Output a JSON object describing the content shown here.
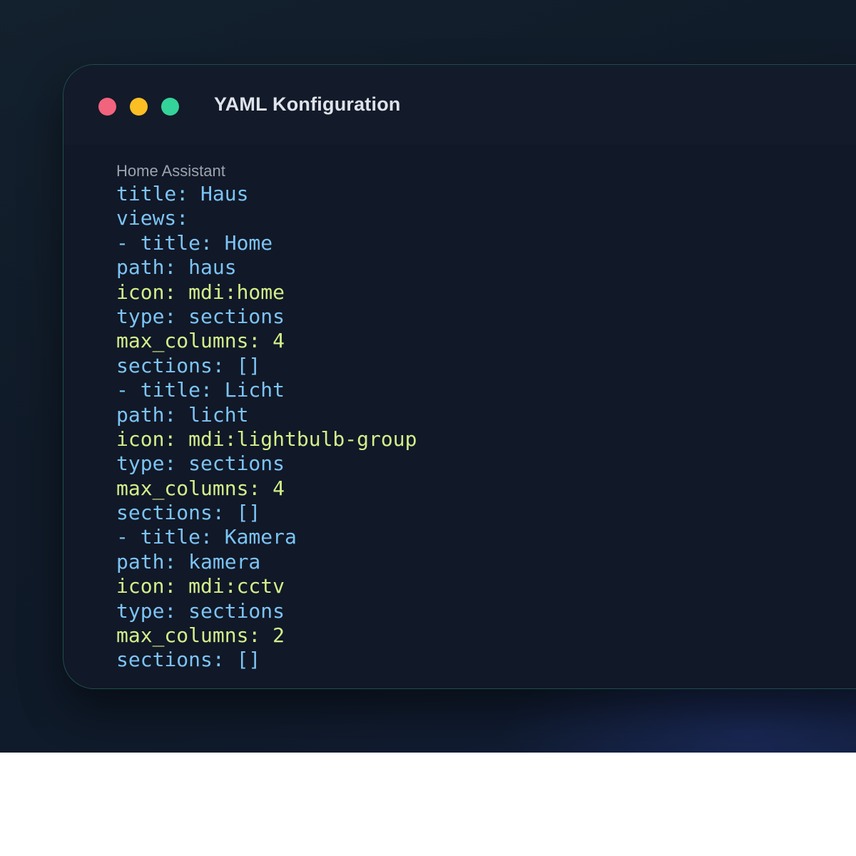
{
  "window": {
    "title": "YAML Konfiguration",
    "controls": {
      "close_color": "#f2637e",
      "minimize_color": "#fbbf24",
      "maximize_color": "#34d399"
    }
  },
  "editor": {
    "caption": "Home Assistant",
    "colors": {
      "key_blue": "#7cc4f5",
      "value_green": "#d4ee8b"
    },
    "lines": [
      {
        "text": "title: Haus",
        "color": "blue"
      },
      {
        "text": "views:",
        "color": "blue"
      },
      {
        "text": "- title: Home",
        "color": "blue"
      },
      {
        "text": "path: haus",
        "color": "blue"
      },
      {
        "text": "icon: mdi:home",
        "color": "green"
      },
      {
        "text": "type: sections",
        "color": "blue"
      },
      {
        "text": "max_columns: 4",
        "color": "green"
      },
      {
        "text": "sections: []",
        "color": "blue"
      },
      {
        "text": "- title: Licht",
        "color": "blue"
      },
      {
        "text": "path: licht",
        "color": "blue"
      },
      {
        "text": "icon: mdi:lightbulb-group",
        "color": "green"
      },
      {
        "text": "type: sections",
        "color": "blue"
      },
      {
        "text": "max_columns: 4",
        "color": "green"
      },
      {
        "text": "sections: []",
        "color": "blue"
      },
      {
        "text": "- title: Kamera",
        "color": "blue"
      },
      {
        "text": "path: kamera",
        "color": "blue"
      },
      {
        "text": "icon: mdi:cctv",
        "color": "green"
      },
      {
        "text": "type: sections",
        "color": "blue"
      },
      {
        "text": "max_columns: 2",
        "color": "green"
      },
      {
        "text": "sections: []",
        "color": "blue"
      }
    ]
  }
}
